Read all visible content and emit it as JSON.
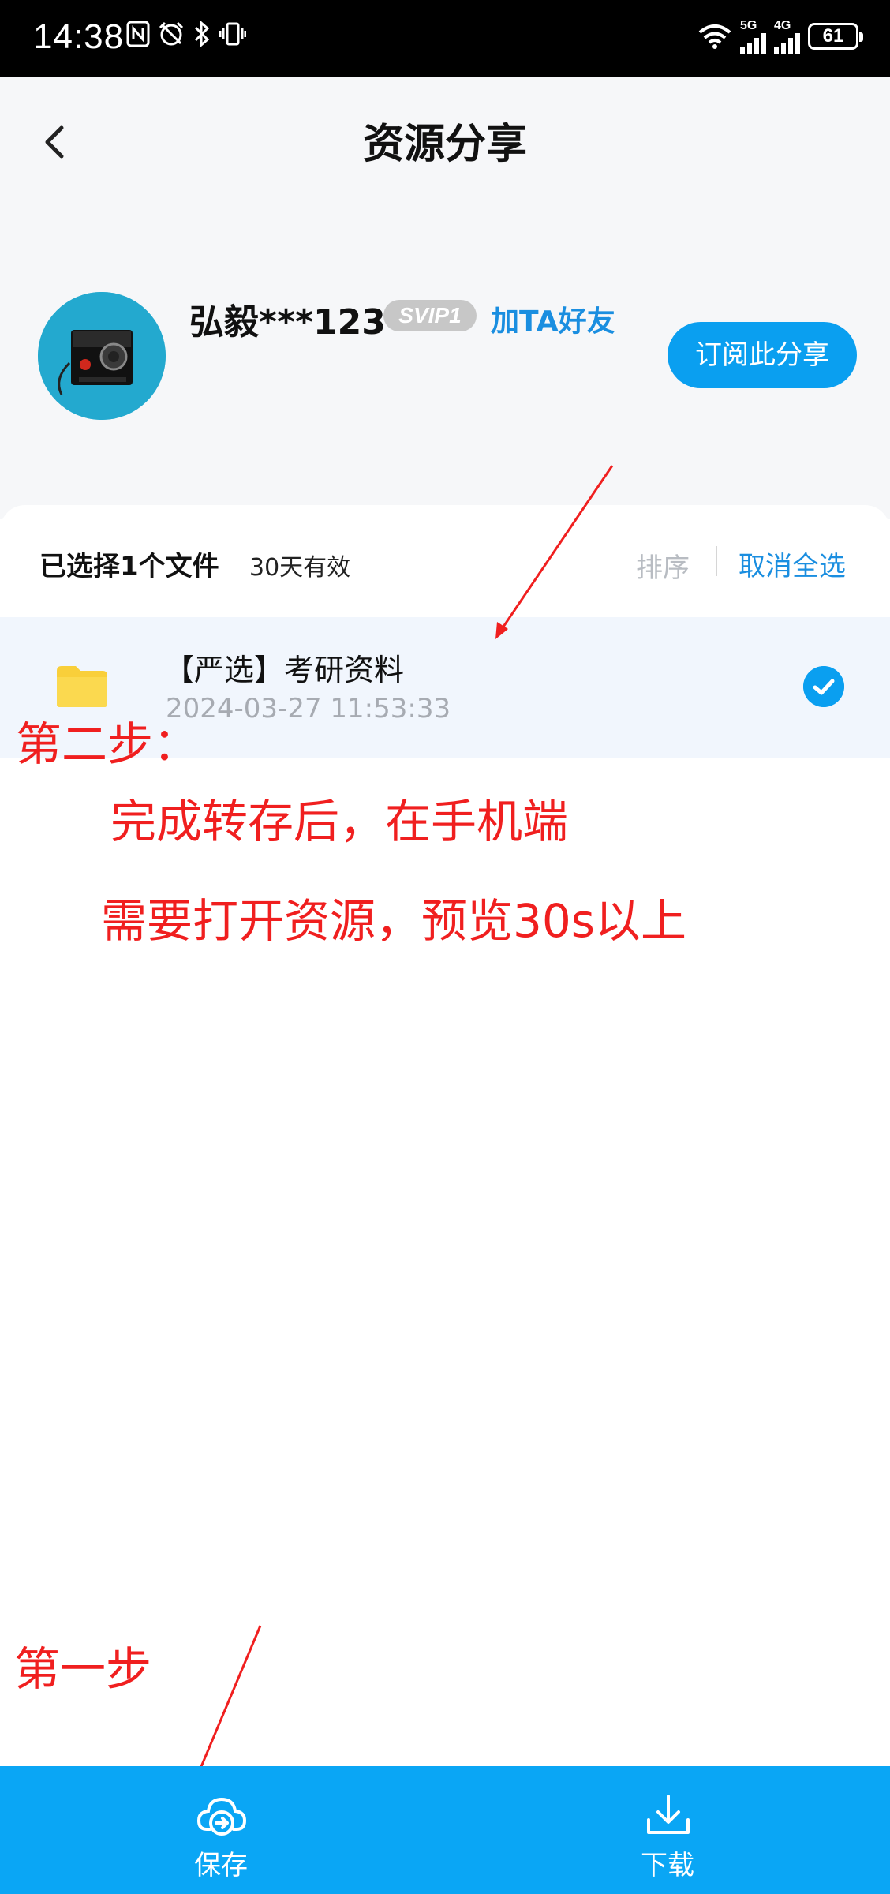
{
  "status_bar": {
    "time": "14:38",
    "signal_1": "5G",
    "signal_2": "4G",
    "battery": "61"
  },
  "header": {
    "title": "资源分享"
  },
  "sharer": {
    "username": "弘毅***123",
    "badge": "SVIP1",
    "add_friend": "加TA好友",
    "subscribe": "订阅此分享"
  },
  "list_header": {
    "selected_count": "已选择1个文件",
    "valid_days": "30天有效",
    "sort": "排序",
    "deselect_all": "取消全选"
  },
  "files": [
    {
      "name": "【严选】考研资料",
      "time": "2024-03-27  11:53:33",
      "selected": true
    }
  ],
  "annotations": {
    "step2_title": "第二步：",
    "step2_line1": "完成转存后，在手机端",
    "step2_line2": "需要打开资源，预览30s以上",
    "step1_title": "第一步",
    "color": "#f01f1f"
  },
  "bottom_bar": {
    "save_label": "保存",
    "download_label": "下载"
  },
  "colors": {
    "accent": "#0a9ff0",
    "bottom_bar": "#0aa6f5",
    "link": "#1a8ee0"
  }
}
